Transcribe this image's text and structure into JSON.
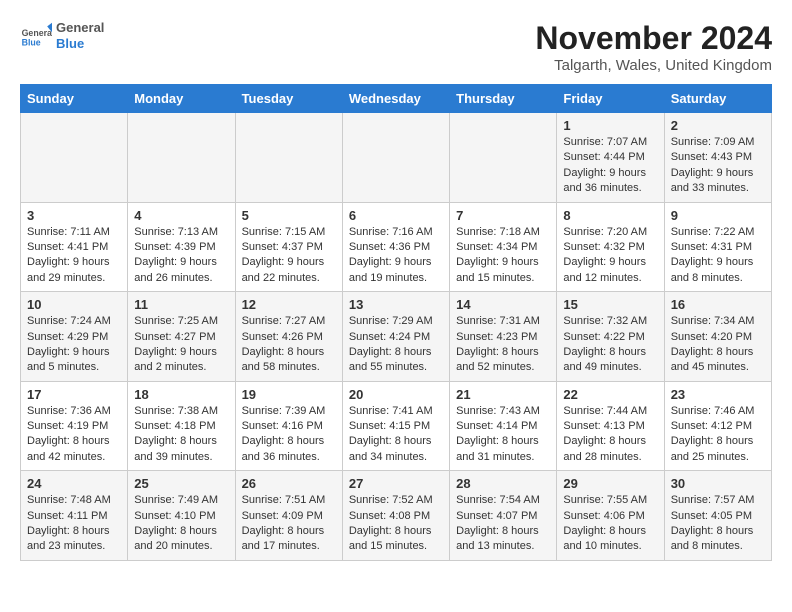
{
  "header": {
    "logo_general": "General",
    "logo_blue": "Blue",
    "title": "November 2024",
    "location": "Talgarth, Wales, United Kingdom"
  },
  "days_of_week": [
    "Sunday",
    "Monday",
    "Tuesday",
    "Wednesday",
    "Thursday",
    "Friday",
    "Saturday"
  ],
  "weeks": [
    [
      {
        "day": "",
        "info": ""
      },
      {
        "day": "",
        "info": ""
      },
      {
        "day": "",
        "info": ""
      },
      {
        "day": "",
        "info": ""
      },
      {
        "day": "",
        "info": ""
      },
      {
        "day": "1",
        "info": "Sunrise: 7:07 AM\nSunset: 4:44 PM\nDaylight: 9 hours and 36 minutes."
      },
      {
        "day": "2",
        "info": "Sunrise: 7:09 AM\nSunset: 4:43 PM\nDaylight: 9 hours and 33 minutes."
      }
    ],
    [
      {
        "day": "3",
        "info": "Sunrise: 7:11 AM\nSunset: 4:41 PM\nDaylight: 9 hours and 29 minutes."
      },
      {
        "day": "4",
        "info": "Sunrise: 7:13 AM\nSunset: 4:39 PM\nDaylight: 9 hours and 26 minutes."
      },
      {
        "day": "5",
        "info": "Sunrise: 7:15 AM\nSunset: 4:37 PM\nDaylight: 9 hours and 22 minutes."
      },
      {
        "day": "6",
        "info": "Sunrise: 7:16 AM\nSunset: 4:36 PM\nDaylight: 9 hours and 19 minutes."
      },
      {
        "day": "7",
        "info": "Sunrise: 7:18 AM\nSunset: 4:34 PM\nDaylight: 9 hours and 15 minutes."
      },
      {
        "day": "8",
        "info": "Sunrise: 7:20 AM\nSunset: 4:32 PM\nDaylight: 9 hours and 12 minutes."
      },
      {
        "day": "9",
        "info": "Sunrise: 7:22 AM\nSunset: 4:31 PM\nDaylight: 9 hours and 8 minutes."
      }
    ],
    [
      {
        "day": "10",
        "info": "Sunrise: 7:24 AM\nSunset: 4:29 PM\nDaylight: 9 hours and 5 minutes."
      },
      {
        "day": "11",
        "info": "Sunrise: 7:25 AM\nSunset: 4:27 PM\nDaylight: 9 hours and 2 minutes."
      },
      {
        "day": "12",
        "info": "Sunrise: 7:27 AM\nSunset: 4:26 PM\nDaylight: 8 hours and 58 minutes."
      },
      {
        "day": "13",
        "info": "Sunrise: 7:29 AM\nSunset: 4:24 PM\nDaylight: 8 hours and 55 minutes."
      },
      {
        "day": "14",
        "info": "Sunrise: 7:31 AM\nSunset: 4:23 PM\nDaylight: 8 hours and 52 minutes."
      },
      {
        "day": "15",
        "info": "Sunrise: 7:32 AM\nSunset: 4:22 PM\nDaylight: 8 hours and 49 minutes."
      },
      {
        "day": "16",
        "info": "Sunrise: 7:34 AM\nSunset: 4:20 PM\nDaylight: 8 hours and 45 minutes."
      }
    ],
    [
      {
        "day": "17",
        "info": "Sunrise: 7:36 AM\nSunset: 4:19 PM\nDaylight: 8 hours and 42 minutes."
      },
      {
        "day": "18",
        "info": "Sunrise: 7:38 AM\nSunset: 4:18 PM\nDaylight: 8 hours and 39 minutes."
      },
      {
        "day": "19",
        "info": "Sunrise: 7:39 AM\nSunset: 4:16 PM\nDaylight: 8 hours and 36 minutes."
      },
      {
        "day": "20",
        "info": "Sunrise: 7:41 AM\nSunset: 4:15 PM\nDaylight: 8 hours and 34 minutes."
      },
      {
        "day": "21",
        "info": "Sunrise: 7:43 AM\nSunset: 4:14 PM\nDaylight: 8 hours and 31 minutes."
      },
      {
        "day": "22",
        "info": "Sunrise: 7:44 AM\nSunset: 4:13 PM\nDaylight: 8 hours and 28 minutes."
      },
      {
        "day": "23",
        "info": "Sunrise: 7:46 AM\nSunset: 4:12 PM\nDaylight: 8 hours and 25 minutes."
      }
    ],
    [
      {
        "day": "24",
        "info": "Sunrise: 7:48 AM\nSunset: 4:11 PM\nDaylight: 8 hours and 23 minutes."
      },
      {
        "day": "25",
        "info": "Sunrise: 7:49 AM\nSunset: 4:10 PM\nDaylight: 8 hours and 20 minutes."
      },
      {
        "day": "26",
        "info": "Sunrise: 7:51 AM\nSunset: 4:09 PM\nDaylight: 8 hours and 17 minutes."
      },
      {
        "day": "27",
        "info": "Sunrise: 7:52 AM\nSunset: 4:08 PM\nDaylight: 8 hours and 15 minutes."
      },
      {
        "day": "28",
        "info": "Sunrise: 7:54 AM\nSunset: 4:07 PM\nDaylight: 8 hours and 13 minutes."
      },
      {
        "day": "29",
        "info": "Sunrise: 7:55 AM\nSunset: 4:06 PM\nDaylight: 8 hours and 10 minutes."
      },
      {
        "day": "30",
        "info": "Sunrise: 7:57 AM\nSunset: 4:05 PM\nDaylight: 8 hours and 8 minutes."
      }
    ]
  ]
}
